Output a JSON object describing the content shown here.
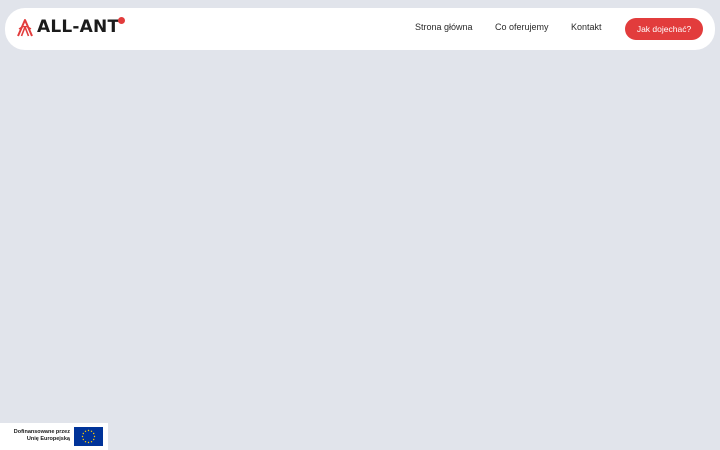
{
  "brand": {
    "name": "ALL-ANT",
    "accent_color": "#e23c3c",
    "icon": "antenna-logo-icon"
  },
  "nav": {
    "items": [
      {
        "label": "Strona główna"
      },
      {
        "label": "Co oferujemy"
      },
      {
        "label": "Kontakt"
      }
    ],
    "cta_label": "Jak dojechać?"
  },
  "eu_badge": {
    "line1": "Dofinansowane przez",
    "line2": "Unię Europejską",
    "icon": "eu-flag-icon",
    "flag_color": "#003399",
    "star_color": "#ffcc00"
  },
  "colors": {
    "background": "#e1e4eb",
    "navbar": "#ffffff"
  }
}
